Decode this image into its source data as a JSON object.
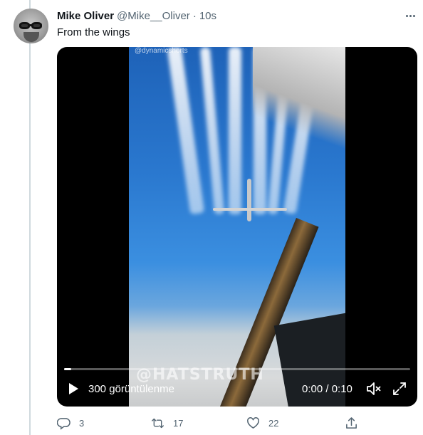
{
  "tweet": {
    "author_name": "Mike Oliver",
    "author_handle": "@Mike__Oliver",
    "separator": "·",
    "time": "10s",
    "text": "From the wings"
  },
  "video": {
    "watermark": "@HATSTRUTH",
    "top_watermark": "@dynamicshorts",
    "views_label": "300 görüntülenme",
    "timecode": "0:00 / 0:10",
    "progress": 0.02
  },
  "actions": {
    "reply_count": "3",
    "retweet_count": "17",
    "like_count": "22"
  },
  "icons": {
    "more": "more-options-icon",
    "play": "play-icon",
    "volume": "volume-icon",
    "fullscreen": "fullscreen-icon",
    "reply": "reply-icon",
    "retweet": "retweet-icon",
    "like": "like-icon",
    "share": "share-icon"
  },
  "colors": {
    "text_primary": "#0f1419",
    "text_secondary": "#536471",
    "thread_line": "#cfd9de"
  }
}
